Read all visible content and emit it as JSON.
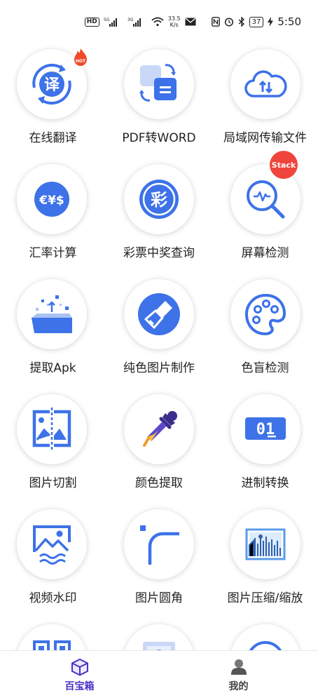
{
  "status_bar": {
    "hd": "HD",
    "net1": "5G",
    "net2": "3G",
    "speed_value": "33.5",
    "speed_unit": "K/s",
    "battery": "37",
    "time": "5:50"
  },
  "colors": {
    "accent": "#3d72e8",
    "badge": "#f0453c",
    "active_tab": "#4b30c8"
  },
  "badges": {
    "hot": "HOT",
    "stack": "Stack"
  },
  "tools": [
    {
      "label": "在线翻译",
      "icon": "translate-icon"
    },
    {
      "label": "PDF转WORD",
      "icon": "pdf-convert-icon"
    },
    {
      "label": "局域网传输文件",
      "icon": "cloud-transfer-icon"
    },
    {
      "label": "汇率计算",
      "icon": "currency-icon"
    },
    {
      "label": "彩票中奖查询",
      "icon": "lottery-icon"
    },
    {
      "label": "屏幕检测",
      "icon": "screen-check-icon"
    },
    {
      "label": "提取Apk",
      "icon": "extract-apk-icon"
    },
    {
      "label": "纯色图片制作",
      "icon": "paint-brush-icon"
    },
    {
      "label": "色盲检测",
      "icon": "palette-icon"
    },
    {
      "label": "图片切割",
      "icon": "image-cut-icon"
    },
    {
      "label": "颜色提取",
      "icon": "color-picker-icon"
    },
    {
      "label": "进制转换",
      "icon": "binary-convert-icon"
    },
    {
      "label": "视频水印",
      "icon": "video-watermark-icon"
    },
    {
      "label": "图片圆角",
      "icon": "round-corner-icon"
    },
    {
      "label": "图片压缩/缩放",
      "icon": "image-compress-icon"
    },
    {
      "label": "",
      "icon": "qr-icon"
    },
    {
      "label": "",
      "icon": "gallery-icon"
    },
    {
      "label": "",
      "icon": "misc-tool-icon"
    }
  ],
  "translate_glyph": "译",
  "currency_glyph": "€¥$",
  "lottery_glyph": "彩",
  "binary_glyph": "01",
  "nav": {
    "tab_toolbox": "百宝箱",
    "tab_mine": "我的"
  }
}
